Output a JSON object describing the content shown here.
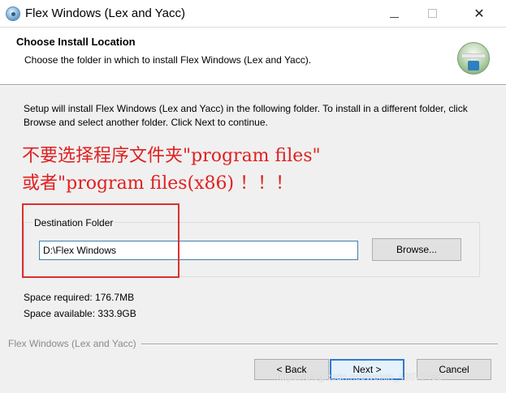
{
  "window": {
    "title": "Flex Windows (Lex and Yacc)",
    "minimize_icon": "minimize-icon",
    "maximize_icon": "maximize-icon",
    "close_glyph": "✕"
  },
  "header": {
    "title": "Choose Install Location",
    "subtitle": "Choose the folder in which to install Flex Windows (Lex and Yacc)."
  },
  "body": {
    "intro": "Setup will install Flex Windows (Lex and Yacc) in the following folder. To install in a different folder, click Browse and select another folder. Click Next to continue.",
    "annotation_line1": "不要选择程序文件夹\"program files\"",
    "annotation_line2": "或者\"program files(x86) ！！！",
    "annotation_color": "#e02020"
  },
  "destination": {
    "group_label": "Destination Folder",
    "path_value": "D:\\Flex Windows",
    "browse_label": "Browse..."
  },
  "space": {
    "required": "Space required: 176.7MB",
    "available": "Space available: 333.9GB"
  },
  "footer": {
    "brand": "Flex Windows (Lex and Yacc)",
    "back_label": "< Back",
    "next_label": "Next >",
    "cancel_label": "Cancel"
  },
  "watermark": "https://blog.csdn.net/weixin_42077433"
}
